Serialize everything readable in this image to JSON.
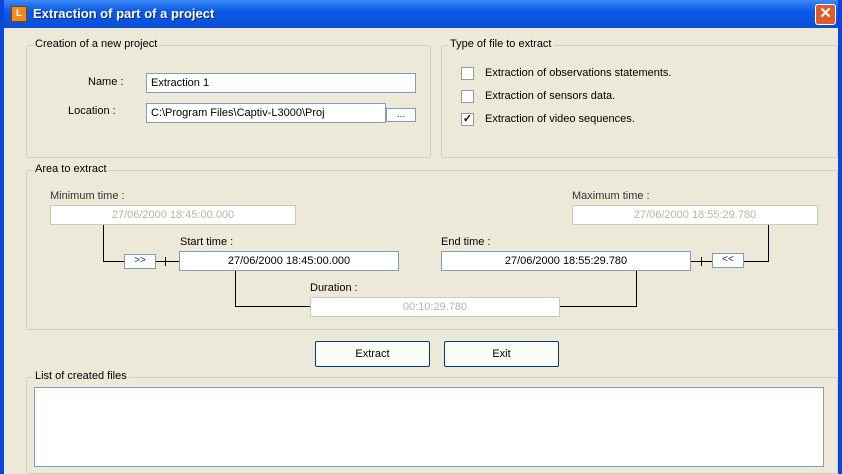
{
  "window": {
    "title": "Extraction of part of a project",
    "icon_name": "app-logo-icon",
    "close_label": "✕"
  },
  "project": {
    "legend": "Creation of a new project",
    "name_label": "Name :",
    "name_value": "Extraction 1",
    "location_label": "Location :",
    "location_value": "C:\\Program Files\\Captiv-L3000\\Proj",
    "browse_label": "..."
  },
  "file_type": {
    "legend": "Type of file to extract",
    "options": [
      {
        "label": "Extraction of observations statements.",
        "checked": false
      },
      {
        "label": "Extraction of sensors data.",
        "checked": false
      },
      {
        "label": "Extraction of video sequences.",
        "checked": true
      }
    ]
  },
  "area": {
    "legend": "Area to extract",
    "min_label": "Minimum time :",
    "min_value": "27/06/2000 18:45:00.000",
    "max_label": "Maximum time :",
    "max_value": "27/06/2000 18:55:29.780",
    "start_label": "Start time :",
    "start_value": "27/06/2000 18:45:00.000",
    "end_label": "End time :",
    "end_value": "27/06/2000 18:55:29.780",
    "duration_label": "Duration :",
    "duration_value": "00:10:29.780",
    "copy_min_label": ">>",
    "copy_max_label": "<<"
  },
  "actions": {
    "extract_label": "Extract",
    "exit_label": "Exit"
  },
  "files": {
    "legend": "List of created files"
  },
  "colors": {
    "titlebar": "#0a5ae6",
    "dialog_bg": "#ece9d8",
    "close_button": "#e05a2a"
  }
}
